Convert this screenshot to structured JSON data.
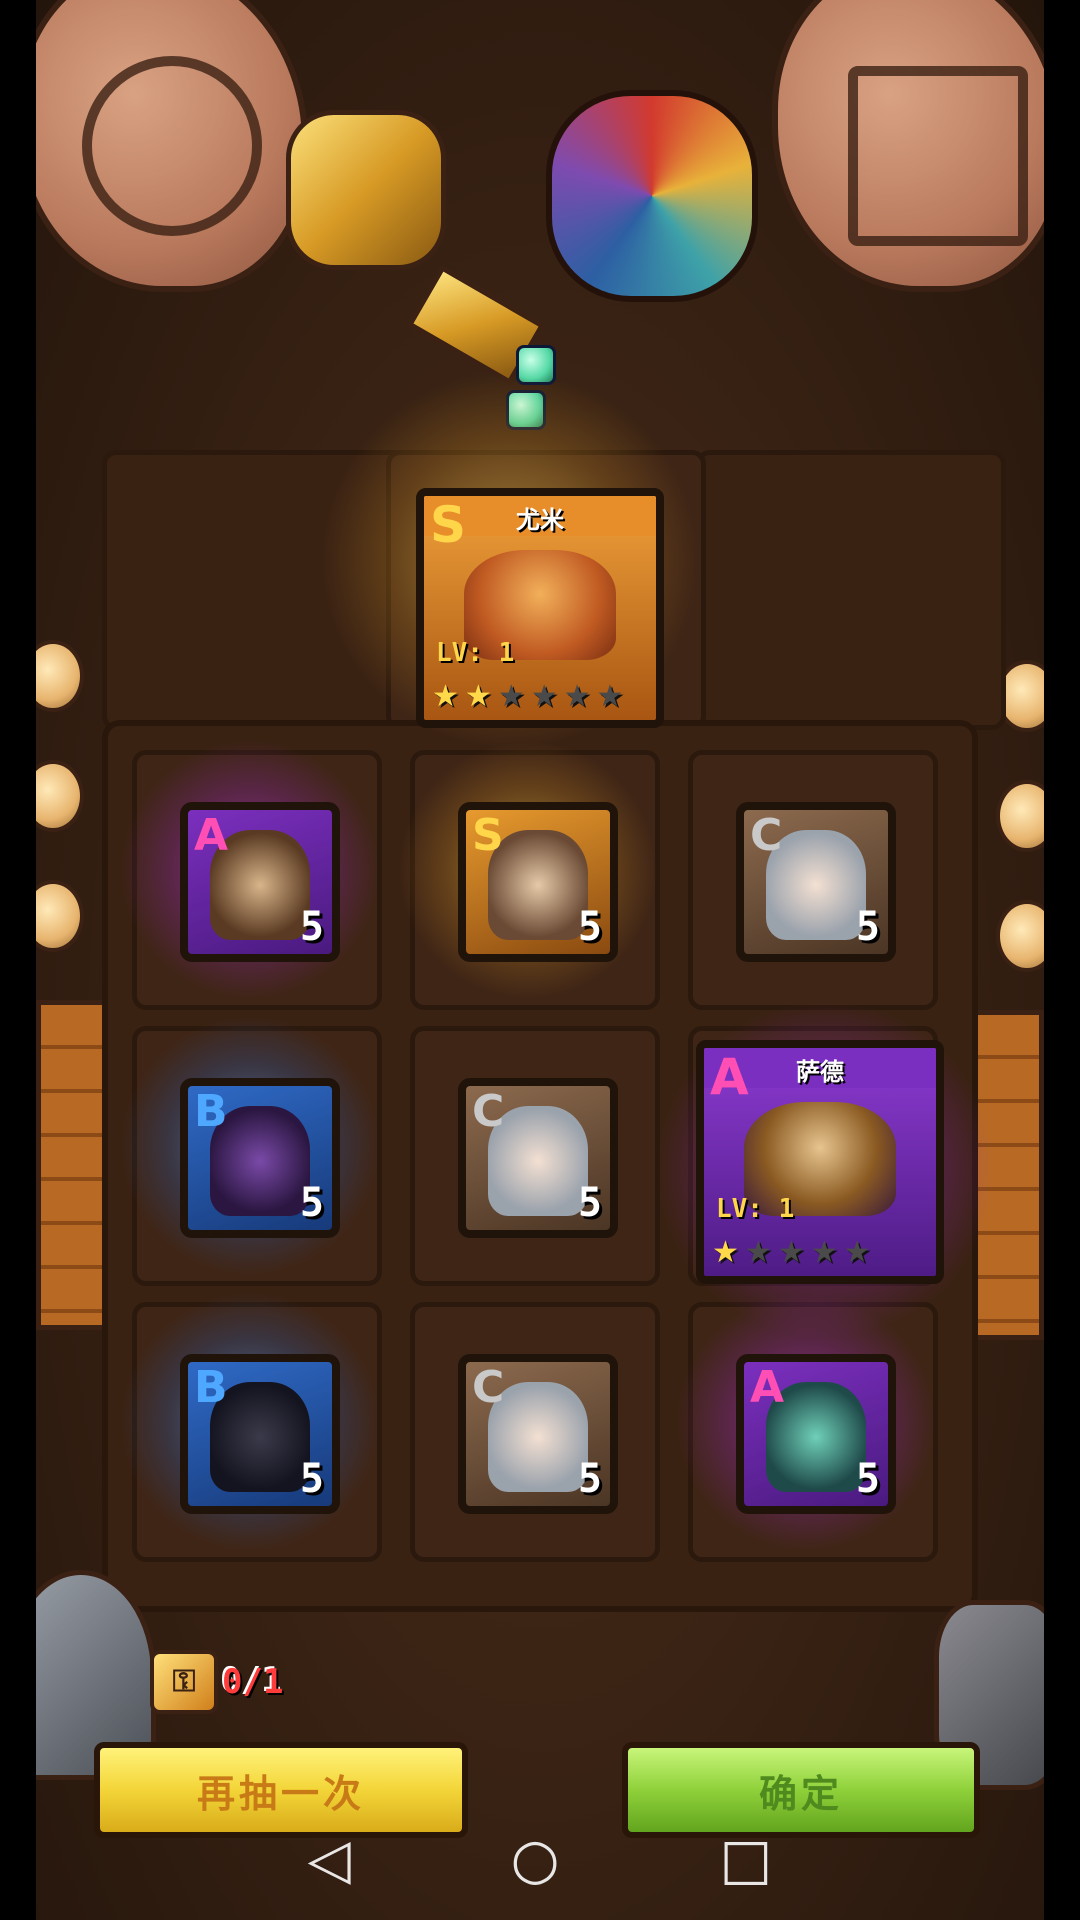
{
  "featured_top": {
    "name": "尤米",
    "grade": "S",
    "level": "LV: 1",
    "stars_on": 2,
    "stars_total": 6
  },
  "grid": [
    {
      "grade": "A",
      "count": "5"
    },
    {
      "grade": "S",
      "count": "5"
    },
    {
      "grade": "C",
      "count": "5"
    },
    {
      "grade": "B",
      "count": "5"
    },
    {
      "grade": "C",
      "count": "5"
    },
    {
      "grade": "B",
      "count": "5"
    },
    {
      "grade": "C",
      "count": "5"
    },
    {
      "grade": "A",
      "count": "5"
    }
  ],
  "featured_side": {
    "name": "萨德",
    "grade": "A",
    "level": "LV: 1",
    "stars_on": 1,
    "stars_total": 5
  },
  "ticket": {
    "value": "0/1"
  },
  "buttons": {
    "retry": "再抽一次",
    "confirm": "确定"
  },
  "nav": {
    "back": "◁",
    "home": "○",
    "recent": "□"
  },
  "colors": {
    "S": "#e79a2e",
    "A": "#7b2fbe",
    "B": "#2f6ac6",
    "C": "#8c6a4e"
  }
}
